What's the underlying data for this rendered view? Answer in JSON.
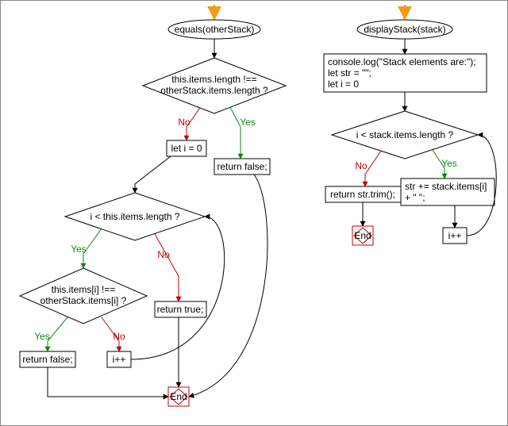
{
  "chart_data": [
    {
      "type": "flowchart",
      "title": "equals(otherStack)",
      "nodes": {
        "start": {
          "shape": "ellipse",
          "label": "equals(otherStack)"
        },
        "d1": {
          "shape": "decision",
          "label": "this.items.length !== otherStack.items.length ?"
        },
        "r_false1": {
          "shape": "process",
          "label": "return false;"
        },
        "let_i": {
          "shape": "process",
          "label": "let i = 0"
        },
        "d2": {
          "shape": "decision",
          "label": "i < this.items.length ?"
        },
        "r_true": {
          "shape": "process",
          "label": "return true;"
        },
        "d3": {
          "shape": "decision",
          "label": "this.items[i] !== otherStack.items[i] ?"
        },
        "r_false2": {
          "shape": "process",
          "label": "return false;"
        },
        "inc": {
          "shape": "process",
          "label": "i++"
        },
        "end": {
          "shape": "end",
          "label": "End"
        }
      },
      "edges": [
        {
          "from": "arrow_in",
          "to": "start"
        },
        {
          "from": "start",
          "to": "d1"
        },
        {
          "from": "d1",
          "to": "r_false1",
          "label": "Yes"
        },
        {
          "from": "d1",
          "to": "let_i",
          "label": "No"
        },
        {
          "from": "let_i",
          "to": "d2"
        },
        {
          "from": "d2",
          "to": "d3",
          "label": "Yes"
        },
        {
          "from": "d2",
          "to": "r_true",
          "label": "No"
        },
        {
          "from": "d3",
          "to": "r_false2",
          "label": "Yes"
        },
        {
          "from": "d3",
          "to": "inc",
          "label": "No"
        },
        {
          "from": "inc",
          "to": "d2"
        },
        {
          "from": "r_false1",
          "to": "end"
        },
        {
          "from": "r_true",
          "to": "end"
        },
        {
          "from": "r_false2",
          "to": "end"
        }
      ]
    },
    {
      "type": "flowchart",
      "title": "displayStack(stack)",
      "nodes": {
        "start": {
          "shape": "ellipse",
          "label": "displayStack(stack)"
        },
        "init": {
          "shape": "process",
          "label": "console.log(\"Stack elements are:\");\nlet str = \"\";\nlet i = 0"
        },
        "d1": {
          "shape": "decision",
          "label": "i < stack.items.length ?"
        },
        "append": {
          "shape": "process",
          "label": "str += stack.items[i] + \" \";"
        },
        "inc": {
          "shape": "process",
          "label": "i++"
        },
        "ret": {
          "shape": "process",
          "label": "return str.trim();"
        },
        "end": {
          "shape": "end",
          "label": "End"
        }
      },
      "edges": [
        {
          "from": "arrow_in",
          "to": "start"
        },
        {
          "from": "start",
          "to": "init"
        },
        {
          "from": "init",
          "to": "d1"
        },
        {
          "from": "d1",
          "to": "append",
          "label": "Yes"
        },
        {
          "from": "append",
          "to": "inc"
        },
        {
          "from": "inc",
          "to": "d1"
        },
        {
          "from": "d1",
          "to": "ret",
          "label": "No"
        },
        {
          "from": "ret",
          "to": "end"
        }
      ]
    }
  ],
  "left": {
    "start": "equals(otherStack)",
    "d1_l1": "this.items.length !==",
    "d1_l2": "otherStack.items.length ?",
    "let_i": "let i = 0",
    "ret_false": "return false;",
    "d2": "i < this.items.length ?",
    "ret_true": "return true;",
    "d3_l1": "this.items[i] !==",
    "d3_l2": "otherStack.items[i] ?",
    "ret_false2": "return false;",
    "inc": "i++",
    "end": "End"
  },
  "right": {
    "start": "displayStack(stack)",
    "init_l1": "console.log(\"Stack elements are:\");",
    "init_l2": "let str = \"\";",
    "init_l3": "let i = 0",
    "d1": "i < stack.items.length ?",
    "append_l1": "str += stack.items[i]",
    "append_l2": "+ \" \";",
    "inc": "i++",
    "ret": "return str.trim();",
    "end": "End"
  },
  "labels": {
    "yes": "Yes",
    "no": "No"
  }
}
